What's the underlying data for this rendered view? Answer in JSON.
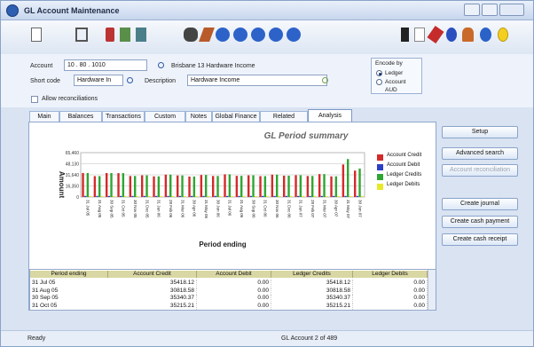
{
  "window": {
    "title": "GL Account Maintenance"
  },
  "form": {
    "account_label": "Account",
    "account_value": "10 . 80 . 1010",
    "account_name": "Brisbane 13 Hardware Income",
    "short_code_label": "Short code",
    "short_code_value": "Hardware In",
    "description_label": "Description",
    "description_value": "Hardware Income",
    "allow_recon_label": "Allow reconciliations",
    "encode_by_label": "Encode by",
    "encode_ledger": "Ledger",
    "encode_account": "Account",
    "currency": "AUD"
  },
  "tabs": [
    "Main",
    "Balances",
    "Transactions",
    "Custom",
    "Notes",
    "Global Finance",
    "Related",
    "Analysis"
  ],
  "active_tab": "Analysis",
  "chart_data": {
    "type": "bar",
    "title": "GL Period summary",
    "xlabel": "Period ending",
    "ylabel": "Amount",
    "yticks": [
      "65,460",
      "48,130",
      "31,640",
      "16,350",
      "0"
    ],
    "ylim": [
      0,
      65460
    ],
    "categories": [
      "31 Jul 05",
      "31 Aug 05",
      "30 Sep 05",
      "31 Oct 05",
      "30 Nov 05",
      "31 Dec 05",
      "31 Jan 06",
      "28 Feb 06",
      "31 Mar 06",
      "30 Apr 06",
      "31 May 06",
      "30 Jun 06",
      "31 Jul 06",
      "31 Aug 06",
      "30 Sep 06",
      "31 Oct 06",
      "30 Nov 06",
      "31 Dec 06",
      "31 Jan 07",
      "28 Feb 07",
      "31 Mar 07",
      "30 Apr 07",
      "31 May 07",
      "30 Jun 07"
    ],
    "series": [
      {
        "name": "Account Credit",
        "color": "#d42a2a",
        "values": [
          35418,
          30818,
          35340,
          35215,
          31000,
          32000,
          30500,
          33000,
          31800,
          30200,
          32500,
          31000,
          33500,
          31200,
          32000,
          30800,
          33000,
          31500,
          32200,
          31000,
          33800,
          30500,
          48000,
          39000
        ]
      },
      {
        "name": "Account Debit",
        "color": "#2b3fc8",
        "values": [
          0,
          0,
          0,
          0,
          0,
          0,
          0,
          0,
          0,
          0,
          0,
          0,
          0,
          0,
          0,
          0,
          0,
          0,
          0,
          0,
          0,
          0,
          0,
          0
        ]
      },
      {
        "name": "Ledger Credits",
        "color": "#2ea632",
        "values": [
          35418,
          30818,
          35340,
          35215,
          31000,
          32000,
          30500,
          33000,
          31800,
          30200,
          32500,
          31000,
          33500,
          31200,
          32000,
          30800,
          33000,
          31500,
          32200,
          31000,
          33800,
          30500,
          56000,
          42000
        ]
      },
      {
        "name": "Ledger Debits",
        "color": "#e8e82a",
        "values": [
          0,
          0,
          0,
          0,
          0,
          0,
          0,
          0,
          0,
          0,
          0,
          0,
          0,
          0,
          0,
          0,
          0,
          0,
          0,
          0,
          0,
          0,
          0,
          0
        ]
      }
    ],
    "grid": true,
    "legend": "right"
  },
  "table": {
    "columns": [
      "Period ending",
      "Account Credit",
      "Account Debit",
      "Ledger Credits",
      "Ledger Debits"
    ],
    "rows": [
      [
        "31 Jul 05",
        "35418.12",
        "0.00",
        "35418.12",
        "0.00"
      ],
      [
        "31 Aug 05",
        "30818.58",
        "0.00",
        "30818.58",
        "0.00"
      ],
      [
        "30 Sep 05",
        "35340.37",
        "0.00",
        "35340.37",
        "0.00"
      ],
      [
        "31 Oct 05",
        "35215.21",
        "0.00",
        "35215.21",
        "0.00"
      ]
    ]
  },
  "buttons": [
    "Setup",
    "Advanced search",
    "Account reconciliation",
    "Create journal",
    "Create cash payment",
    "Create cash receipt"
  ],
  "status": {
    "left": "Ready",
    "center": "GL Account 2 of 489"
  }
}
